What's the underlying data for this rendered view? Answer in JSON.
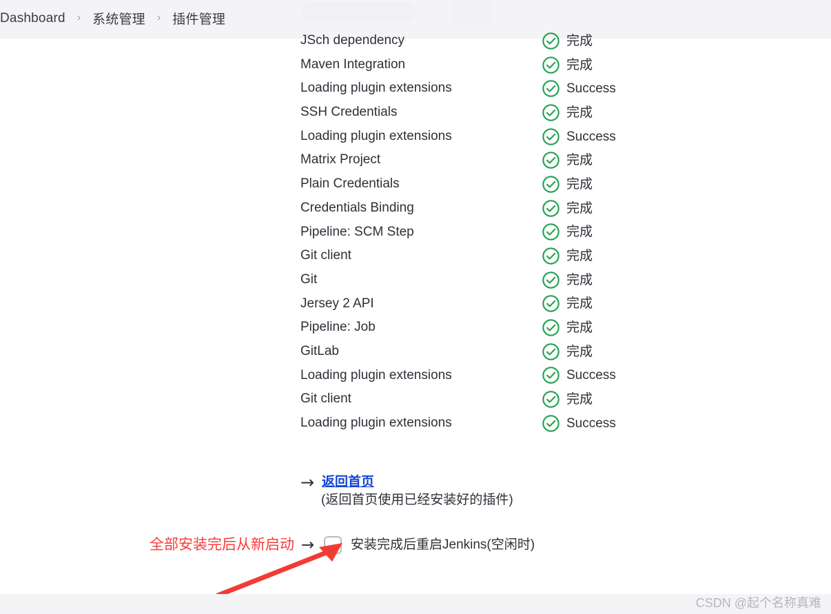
{
  "header": {
    "breadcrumb": [
      {
        "label": "Dashboard",
        "sep": "›"
      },
      {
        "label": "系统管理",
        "sep": "›"
      },
      {
        "label": "插件管理",
        "sep": ""
      }
    ],
    "search_placeholder": ""
  },
  "plugin_install_progress": {
    "rows": [
      {
        "name": "JSch dependency",
        "status": "完成",
        "icon": "check-circle-icon"
      },
      {
        "name": "Maven Integration",
        "status": "完成",
        "icon": "check-circle-icon"
      },
      {
        "name": "Loading plugin extensions",
        "status": "Success",
        "icon": "check-circle-icon"
      },
      {
        "name": "SSH Credentials",
        "status": "完成",
        "icon": "check-circle-icon"
      },
      {
        "name": "Loading plugin extensions",
        "status": "Success",
        "icon": "check-circle-icon"
      },
      {
        "name": "Matrix Project",
        "status": "完成",
        "icon": "check-circle-icon"
      },
      {
        "name": "Plain Credentials",
        "status": "完成",
        "icon": "check-circle-icon"
      },
      {
        "name": "Credentials Binding",
        "status": "完成",
        "icon": "check-circle-icon"
      },
      {
        "name": "Pipeline: SCM Step",
        "status": "完成",
        "icon": "check-circle-icon"
      },
      {
        "name": "Git client",
        "status": "完成",
        "icon": "check-circle-icon"
      },
      {
        "name": "Git",
        "status": "完成",
        "icon": "check-circle-icon"
      },
      {
        "name": "Jersey 2 API",
        "status": "完成",
        "icon": "check-circle-icon"
      },
      {
        "name": "Pipeline: Job",
        "status": "完成",
        "icon": "check-circle-icon"
      },
      {
        "name": "GitLab",
        "status": "完成",
        "icon": "check-circle-icon"
      },
      {
        "name": "Loading plugin extensions",
        "status": "Success",
        "icon": "check-circle-icon"
      },
      {
        "name": "Git client",
        "status": "完成",
        "icon": "check-circle-icon"
      },
      {
        "name": "Loading plugin extensions",
        "status": "Success",
        "icon": "check-circle-icon"
      }
    ],
    "status_color": "#20a04f"
  },
  "return_home": {
    "arrow_glyph": "→",
    "link_label": "返回首页",
    "note": "(返回首页使用已经安装好的插件)",
    "link_color": "#1346d0"
  },
  "restart_option": {
    "arrow_glyph": "→",
    "label": "安装完成后重启Jenkins(空闲时)",
    "checked": false
  },
  "annotation": {
    "text": "全部安装完后从新启动",
    "color": "#fb3b3b"
  },
  "footer": {
    "watermark": "CSDN @起个名称真难"
  }
}
